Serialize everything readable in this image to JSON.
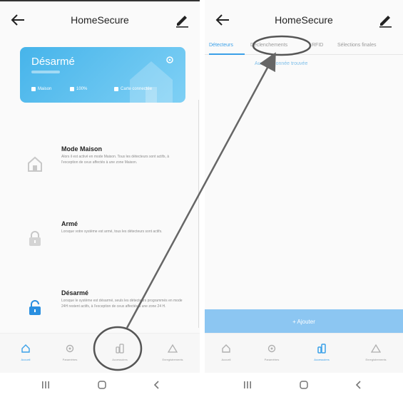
{
  "left": {
    "title": "HomeSecure",
    "status": {
      "state": "Désarmé",
      "info": [
        "Maison",
        "100%",
        "Carte connectée"
      ]
    },
    "modes": [
      {
        "title": "Mode Maison",
        "desc": "Alors il est activé en mode Maison. Tous les détecteurs sont actifs, à l'exception de ceux affectés à une zone Maison."
      },
      {
        "title": "Armé",
        "desc": "Lorsque votre système est armé, tous les détecteurs sont actifs."
      },
      {
        "title": "Désarmé",
        "desc": "Lorsque le système est désarmé, seuls les détecteurs programmés en mode 24H restent actifs, à l'exception de ceux affectés à une zone 24 H."
      }
    ],
    "nav": [
      "Accueil",
      "Paramètres",
      "Accessoires",
      "Enregistrements"
    ]
  },
  "right": {
    "title": "HomeSecure",
    "tabs": [
      "Détecteurs",
      "Déclenchements",
      "RFID",
      "Sélections finales"
    ],
    "empty_message": "Aucune donnée trouvée",
    "add_label": "+ Ajouter",
    "nav": [
      "Accueil",
      "Paramètres",
      "Accessoires",
      "Enregistrements"
    ]
  },
  "colors": {
    "accent": "#3aa0e8",
    "card": "#46b4ea",
    "annotation": "#666666"
  }
}
